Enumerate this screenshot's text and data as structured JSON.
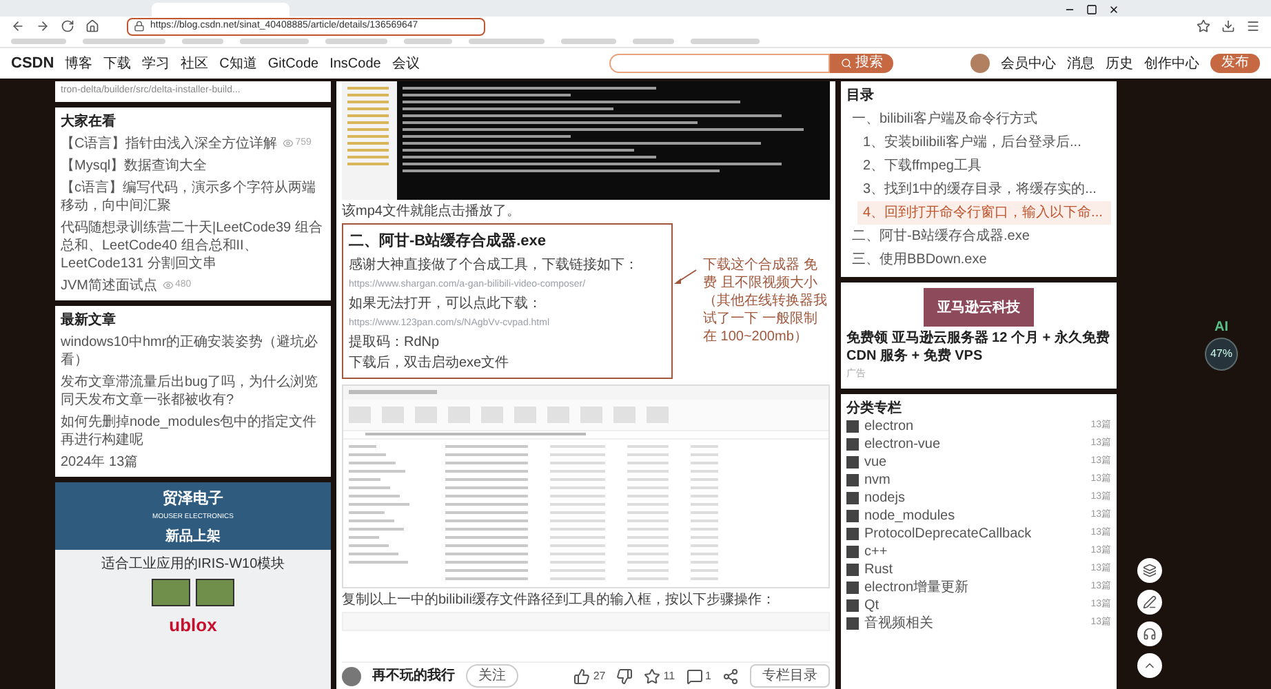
{
  "browser": {
    "url": "https://blog.csdn.net/sinat_40408885/article/details/136569647"
  },
  "nav": {
    "logo": "CSDN",
    "links": [
      "博客",
      "下载",
      "学习",
      "社区",
      "C知道",
      "GitCode",
      "InsCode",
      "会议"
    ],
    "search_button": "搜索",
    "right_links": [
      "会员中心",
      "消息",
      "历史",
      "创作中心"
    ],
    "publish_button": "发布"
  },
  "left_sidebar": {
    "top_line": "tron-delta/builder/src/delta-installer-build...",
    "trending": {
      "title": "大家在看",
      "items": [
        {
          "text": "【C语言】指针由浅入深全方位详解",
          "count": "759"
        },
        {
          "text": "【Mysql】数据查询大全"
        },
        {
          "text": "【c语言】编写代码，演示多个字符从两端移动，向中间汇聚"
        },
        {
          "text": "代码随想录训练营二十天|LeetCode39 组合总和、LeetCode40 组合总和II、LeetCode131 分割回文串"
        },
        {
          "text": "JVM简述面试点",
          "count": "480"
        }
      ]
    },
    "latest": {
      "title": "最新文章",
      "items": [
        "windows10中hmr的正确安装姿势（避坑必看）",
        "发布文章滞流量后出bug了吗，为什么浏览同天发布文章一张都被收有?",
        "如何先删掉node_modules包中的指定文件再进行构建呢"
      ],
      "footer": "2024年 13篇"
    },
    "ad": {
      "brand": "贸泽电子",
      "brand_en": "MOUSER ELECTRONICS",
      "tagline": "新品上架",
      "headline": "适合工业应用的IRIS-W10模块",
      "logo": "ublox"
    }
  },
  "article": {
    "intro_text": "该mp4文件就能点击播放了。",
    "section": {
      "heading": "二、阿甘-B站缓存合成器.exe",
      "lines": [
        {
          "kind": "text",
          "text": "感谢大神直接做了个合成工具，下载链接如下："
        },
        {
          "kind": "link",
          "text": "https://www.shargan.com/a-gan-bilibili-video-composer/"
        },
        {
          "kind": "text",
          "text": "如果无法打开，可以点此下载："
        },
        {
          "kind": "link",
          "text": "https://www.123pan.com/s/NAgbVv-cvpad.html"
        },
        {
          "kind": "text",
          "text": "提取码：RdNp"
        },
        {
          "kind": "text",
          "text": "下载后，双击启动exe文件"
        }
      ]
    },
    "annotation": "下载这个合成器 免费 且不限视频大小（其他在线转换器我试了一下 一般限制在 100~200mb）",
    "step_text": "复制以上一中的bilibili缓存文件路径到工具的输入框，按以下步骤操作：",
    "author": {
      "name": "再不玩的我行",
      "follow_button": "关注"
    },
    "actions": [
      {
        "kind": "like",
        "count": "27"
      },
      {
        "kind": "dislike"
      },
      {
        "kind": "star",
        "count": "11"
      },
      {
        "kind": "comment",
        "count": "1"
      },
      {
        "kind": "share"
      }
    ],
    "toc_button": "专栏目录"
  },
  "right_sidebar": {
    "toc": {
      "title": "目录",
      "items": [
        {
          "text": "一、bilibili客户端及命令行方式",
          "selected": false,
          "children": [
            {
              "text": "1、安装bilibili客户端，后台登录后...",
              "selected": false
            },
            {
              "text": "2、下载ffmpeg工具",
              "selected": false
            },
            {
              "text": "3、找到1中的缓存目录，将缓存实的...",
              "selected": false
            },
            {
              "text": "4、回到打开命令行窗口，输入以下命...",
              "selected": true
            }
          ]
        },
        {
          "text": "二、阿甘-B站缓存合成器.exe",
          "selected": false
        },
        {
          "text": "三、使用BBDown.exe",
          "selected": false
        }
      ]
    },
    "ad": {
      "image_text": "亚马逊云科技",
      "title": "免费领 亚马逊云服务器 12 个月 + 永久免费 CDN 服务 + 免费 VPS",
      "label": "广告"
    },
    "columns": {
      "title": "分类专栏",
      "items": [
        {
          "name": "electron",
          "count": "13篇"
        },
        {
          "name": "electron-vue",
          "count": "13篇"
        },
        {
          "name": "vue",
          "count": "13篇"
        },
        {
          "name": "nvm",
          "count": "13篇"
        },
        {
          "name": "nodejs",
          "count": "13篇"
        },
        {
          "name": "node_modules",
          "count": "13篇"
        },
        {
          "name": "ProtocolDeprecateCallback",
          "count": "13篇"
        },
        {
          "name": "c++",
          "count": "13篇"
        },
        {
          "name": "Rust",
          "count": "13篇"
        },
        {
          "name": "electron增量更新",
          "count": "13篇"
        },
        {
          "name": "Qt",
          "count": "13篇"
        },
        {
          "name": "音视频相关",
          "count": "13篇"
        }
      ]
    }
  },
  "ai_widget": {
    "label": "AI",
    "percent": "47%"
  }
}
